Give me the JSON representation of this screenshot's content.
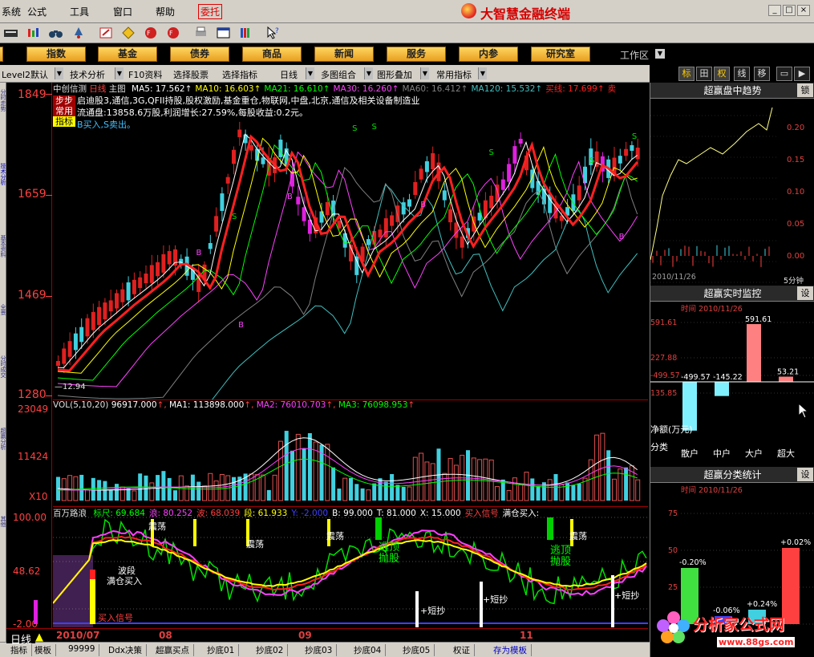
{
  "menu": {
    "items": [
      "系统",
      "公式",
      "工具",
      "窗口",
      "帮助",
      "委托"
    ],
    "app_title": "大智慧金融终端",
    "window_buttons": [
      "_",
      "□",
      "×"
    ]
  },
  "navbar": {
    "buttons": [
      "指数",
      "基金",
      "债券",
      "商品",
      "新闻",
      "服务",
      "内参",
      "研究室"
    ],
    "workspace": "工作区"
  },
  "subtoolbar": {
    "items": [
      "Level2默认",
      "技术分析",
      "F10资料",
      "选择股票",
      "选择指标",
      "日线",
      "多图组合",
      "图形叠加",
      "常用指标"
    ]
  },
  "right_tabs": [
    "标",
    "田",
    "权",
    "线",
    "移",
    "▭",
    "▶"
  ],
  "left_side_tabs": [
    "分时走势",
    "技术分析",
    "基本资料",
    "全景",
    "分时成交",
    "超赢分析",
    "其他"
  ],
  "main": {
    "stock": "中创信测",
    "period": "日线",
    "chart_label": "主图",
    "ma_text": [
      {
        "t": "MA5: 17.562",
        "c": "#ffffff"
      },
      {
        "t": "MA10: 16.603",
        "c": "#ffff00"
      },
      {
        "t": "MA21: 16.610",
        "c": "#00ff00"
      },
      {
        "t": "MA30: 16.260",
        "c": "#ff40ff"
      },
      {
        "t": "MA60: 16.412",
        "c": "#808080"
      },
      {
        "t": "MA120: 15.532",
        "c": "#40c0c0"
      },
      {
        "t": "买线: 17.699",
        "c": "#ff2020"
      },
      {
        "t": "卖",
        "c": "#ff2020"
      }
    ],
    "info_line1": "启迪股3,通信,3G,QFII持股,股权激励,基金重仓,物联网,中盘,北京,通信及相关设备制造业",
    "info_line2": "流通盘:13858.6万股,利润增长:27.59%,每股收益:0.2元。",
    "info_line3": "B买入,S卖出。",
    "tags": [
      "步步",
      "常用",
      "指标"
    ],
    "low_label": "—12.94",
    "y_labels": [
      "1849",
      "1659",
      "1469",
      "1280"
    ],
    "buy_marker": "B",
    "sell_marker": "S"
  },
  "volume": {
    "title": "VOL(5,10,20)",
    "vol": "96917.000",
    "ma1": "MA1: 113898.000",
    "ma2": "MA2: 76010.703",
    "ma3": "MA3: 76098.953",
    "y_labels": [
      "23049",
      "11424",
      "X10"
    ]
  },
  "indicator": {
    "title": "百万路浪",
    "params": [
      {
        "t": "标尺: 69.684",
        "c": "#00ff00"
      },
      {
        "t": "浪: 80.252",
        "c": "#ff40ff"
      },
      {
        "t": "波: 68.039",
        "c": "#ff4040"
      },
      {
        "t": "段: 61.933",
        "c": "#ffff00"
      },
      {
        "t": "Y: -2.000",
        "c": "#4040ff"
      },
      {
        "t": "B: 99.000",
        "c": "#ffffff"
      },
      {
        "t": "T: 81.000",
        "c": "#ffffff"
      },
      {
        "t": "X: 15.000",
        "c": "#ffffff"
      },
      {
        "t": "买入信号",
        "c": "#ff4040"
      },
      {
        "t": "满仓买入:",
        "c": "#ffffff"
      }
    ],
    "y_labels": [
      "100.00",
      "48.62",
      "-2.00"
    ],
    "annotations": {
      "zhendang": "震荡",
      "taoding": "逃顶",
      "paogu": "抛股",
      "boduan": "波段",
      "mancang": "满仓买入",
      "maixin": "买入信号",
      "duanchao": "短抄"
    }
  },
  "xaxis": {
    "labels": [
      "2010/07",
      "08",
      "09",
      "11"
    ]
  },
  "bottom_tabs": [
    "日线",
    "指标",
    "模板",
    "99999",
    "Ddx决策",
    "超赢买点",
    "抄底01",
    "抄底02",
    "抄底03",
    "抄底04",
    "抄底05",
    "权证",
    "存为模板"
  ],
  "right_panel": {
    "trend": {
      "title": "超赢盘中趋势",
      "lock": "锁",
      "y_labels": [
        "0.20",
        "0.15",
        "0.10",
        "0.05",
        "0.00"
      ],
      "date": "2010/11/26",
      "period": "5分钟"
    },
    "realtime": {
      "title": "超赢实时监控",
      "set": "设",
      "time_label": "时间",
      "date": "2010/11/26",
      "y_labels": [
        "591.61",
        "227.88",
        "135.85",
        "-499.57"
      ],
      "bar_values": [
        -499.57,
        -145.22,
        591.61,
        53.21
      ],
      "bar_labels": [
        "-499.57",
        "-145.22",
        "591.61",
        "53.21"
      ],
      "net_label": "净额(万元)",
      "category_label": "分类",
      "categories": [
        "散户",
        "中户",
        "大户",
        "超大"
      ]
    },
    "classify": {
      "title": "超赢分类统计",
      "set": "设",
      "time_label": "时间",
      "date": "2010/11/26",
      "y_labels": [
        "75",
        "50",
        "25",
        "0"
      ],
      "bar_values": [
        -0.2,
        -0.06,
        0.24,
        0.02
      ],
      "bar_labels": [
        "-0.20%",
        "-0.06%",
        "+0.24%",
        "+0.02%"
      ]
    }
  },
  "brand": {
    "name": "分析家公式网",
    "url": "www.88gs.com"
  }
}
